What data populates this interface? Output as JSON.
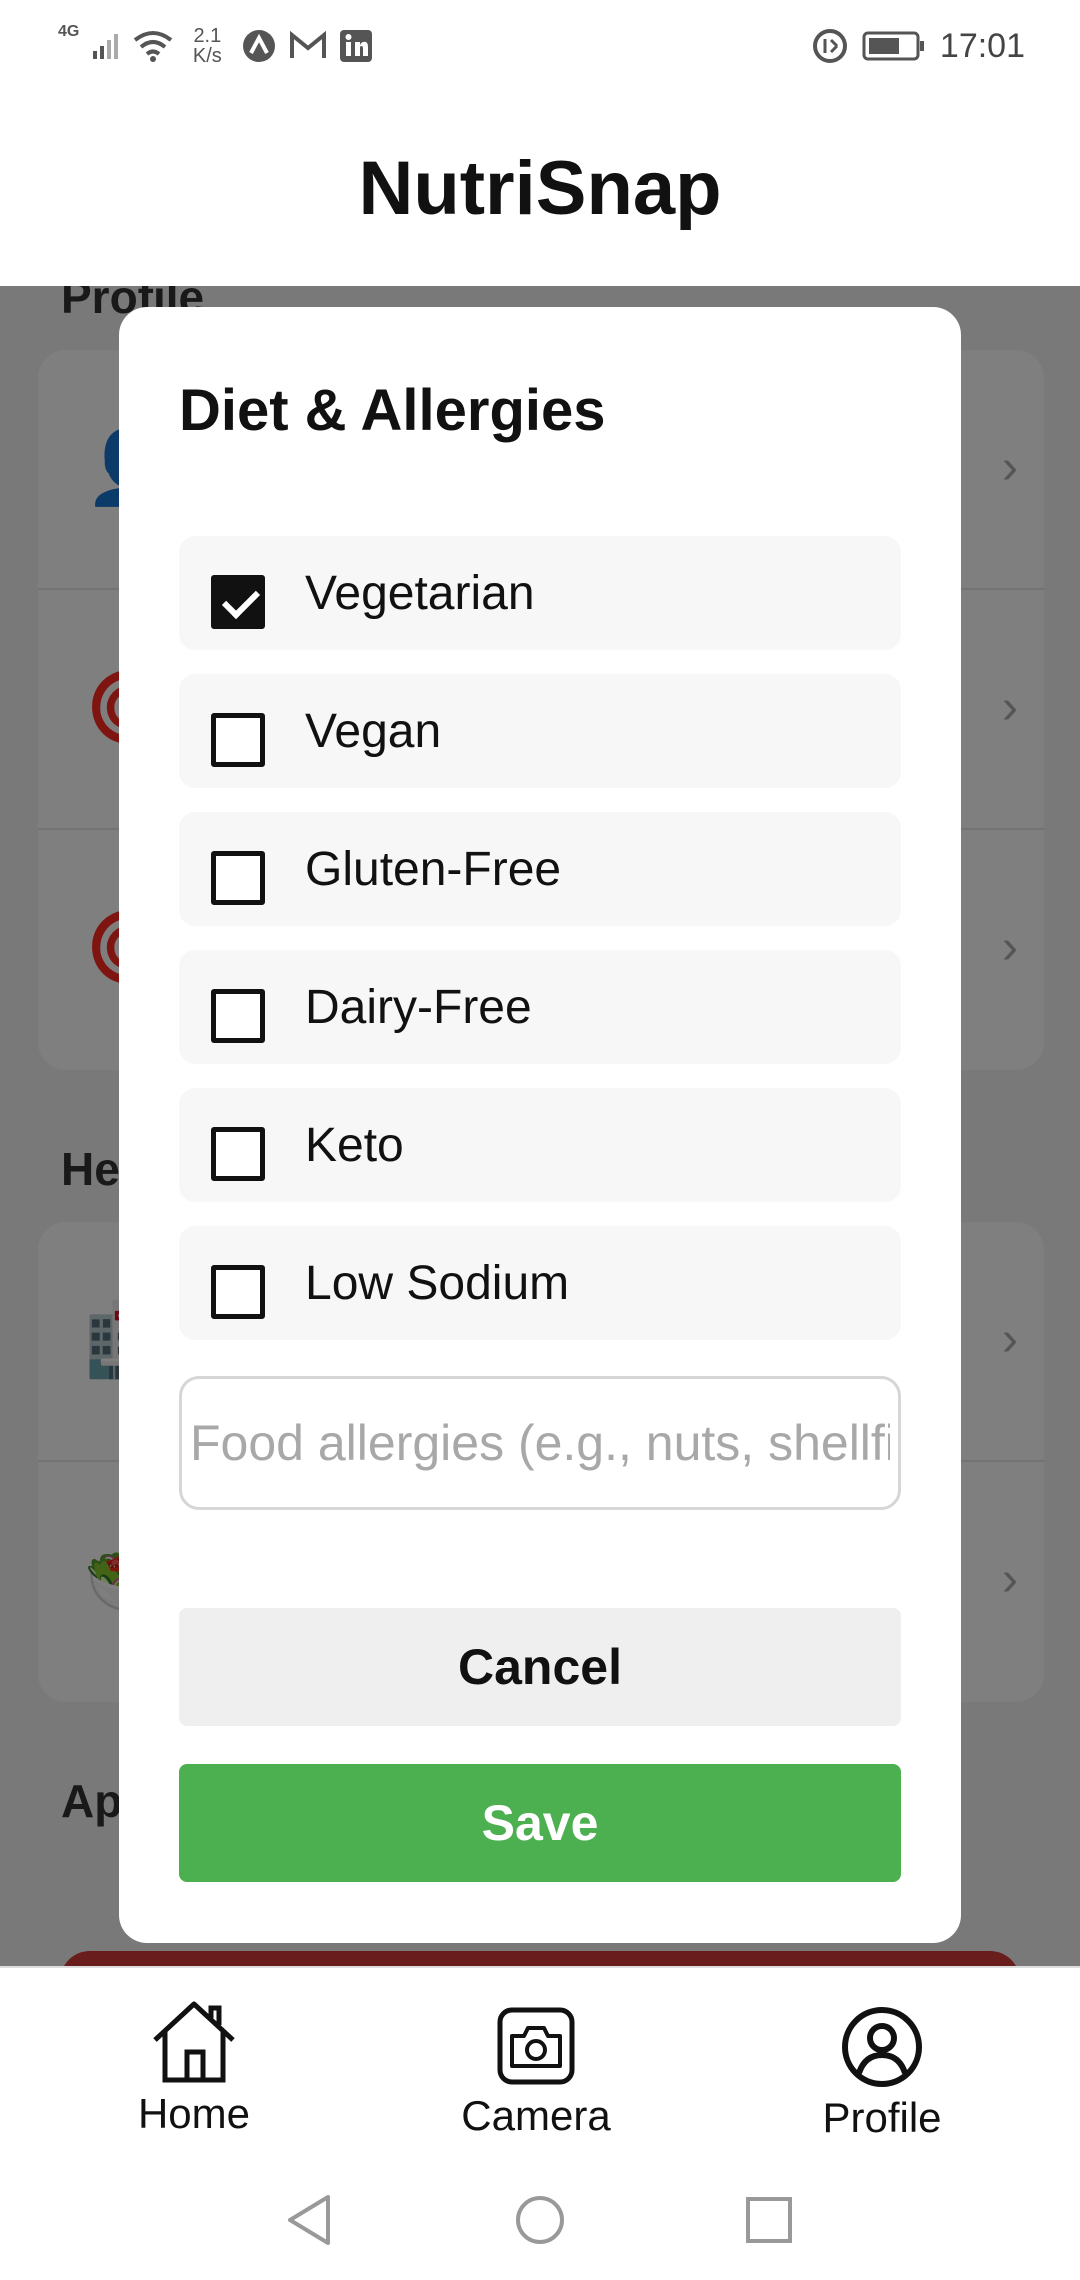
{
  "status_bar": {
    "network": "4G",
    "speed_value": "2.1",
    "speed_unit": "K/s",
    "time": "17:01"
  },
  "app": {
    "title": "NutriSnap"
  },
  "background": {
    "section_profile": "Profile",
    "section_health": "He",
    "section_app": "Ap",
    "row_icons": [
      "person-icon",
      "target-icon",
      "target-icon",
      "hospital-icon",
      "salad-icon"
    ]
  },
  "modal": {
    "title": "Diet & Allergies",
    "options": [
      {
        "label": "Vegetarian",
        "checked": true
      },
      {
        "label": "Vegan",
        "checked": false
      },
      {
        "label": "Gluten-Free",
        "checked": false
      },
      {
        "label": "Dairy-Free",
        "checked": false
      },
      {
        "label": "Keto",
        "checked": false
      },
      {
        "label": "Low Sodium",
        "checked": false
      }
    ],
    "allergy_input": {
      "placeholder": "Food allergies (e.g., nuts, shellfish)",
      "value": ""
    },
    "cancel_label": "Cancel",
    "save_label": "Save",
    "save_color": "#4caf50"
  },
  "nav": {
    "home": "Home",
    "camera": "Camera",
    "profile": "Profile"
  }
}
